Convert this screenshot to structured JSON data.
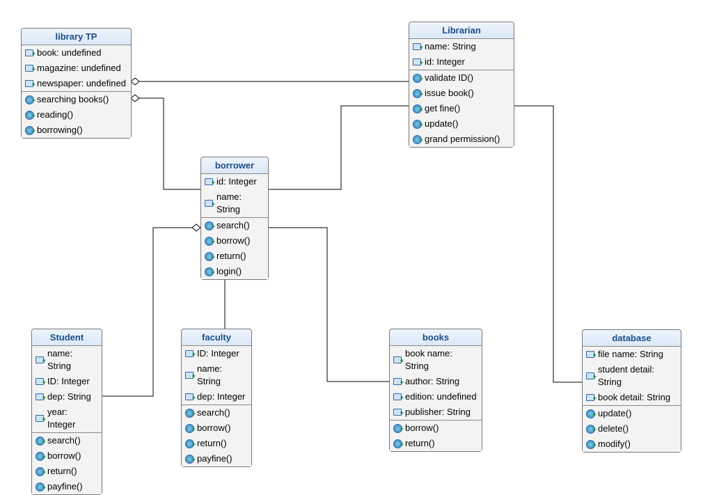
{
  "classes": {
    "libraryTP": {
      "title": "library TP",
      "attrs": [
        "book: undefined",
        "magazine: undefined",
        "newspaper: undefined"
      ],
      "methods": [
        "searching books()",
        "reading()",
        "borrowing()"
      ]
    },
    "librarian": {
      "title": "Librarian",
      "attrs": [
        "name: String",
        "id: Integer"
      ],
      "methods": [
        "validate ID()",
        "issue book()",
        "get fine()",
        "update()",
        "grand permission()"
      ]
    },
    "borrower": {
      "title": "borrower",
      "attrs": [
        "id: Integer",
        "name: String"
      ],
      "methods": [
        "search()",
        "borrow()",
        "return()",
        "login()"
      ]
    },
    "student": {
      "title": "Student",
      "attrs": [
        "name: String",
        "ID: Integer",
        "dep: String",
        "year: Integer"
      ],
      "methods": [
        "search()",
        "borrow()",
        "return()",
        "payfine()"
      ]
    },
    "faculty": {
      "title": "faculty",
      "attrs": [
        "ID: Integer",
        "name: String",
        "dep: Integer"
      ],
      "methods": [
        "search()",
        "borrow()",
        "return()",
        "payfine()"
      ]
    },
    "books": {
      "title": "books",
      "attrs": [
        "book name: String",
        "author: String",
        "edition: undefined",
        "publisher: String"
      ],
      "methods": [
        "borrow()",
        "return()"
      ]
    },
    "database": {
      "title": "database",
      "attrs": [
        "file name: String",
        "student detail: String",
        "book detail: String"
      ],
      "methods": [
        "update()",
        "delete()",
        "modify()"
      ]
    }
  },
  "chart_data": {
    "type": "uml-class-diagram",
    "classes": [
      {
        "name": "library TP",
        "attributes": [
          "book: undefined",
          "magazine: undefined",
          "newspaper: undefined"
        ],
        "operations": [
          "searching books()",
          "reading()",
          "borrowing()"
        ]
      },
      {
        "name": "Librarian",
        "attributes": [
          "name: String",
          "id: Integer"
        ],
        "operations": [
          "validate ID()",
          "issue book()",
          "get fine()",
          "update()",
          "grand permission()"
        ]
      },
      {
        "name": "borrower",
        "attributes": [
          "id: Integer",
          "name: String"
        ],
        "operations": [
          "search()",
          "borrow()",
          "return()",
          "login()"
        ]
      },
      {
        "name": "Student",
        "attributes": [
          "name: String",
          "ID: Integer",
          "dep: String",
          "year: Integer"
        ],
        "operations": [
          "search()",
          "borrow()",
          "return()",
          "payfine()"
        ]
      },
      {
        "name": "faculty",
        "attributes": [
          "ID: Integer",
          "name: String",
          "dep: Integer"
        ],
        "operations": [
          "search()",
          "borrow()",
          "return()",
          "payfine()"
        ]
      },
      {
        "name": "books",
        "attributes": [
          "book name: String",
          "author: String",
          "edition: undefined",
          "publisher: String"
        ],
        "operations": [
          "borrow()",
          "return()"
        ]
      },
      {
        "name": "database",
        "attributes": [
          "file name: String",
          "student detail: String",
          "book detail: String"
        ],
        "operations": [
          "update()",
          "delete()",
          "modify()"
        ]
      }
    ],
    "relationships": [
      {
        "from": "Librarian",
        "to": "library TP",
        "type": "aggregation",
        "diamondAt": "library TP"
      },
      {
        "from": "borrower",
        "to": "library TP",
        "type": "aggregation",
        "diamondAt": "library TP"
      },
      {
        "from": "borrower",
        "to": "Librarian",
        "type": "association"
      },
      {
        "from": "Student",
        "to": "borrower",
        "type": "aggregation",
        "diamondAt": "borrower"
      },
      {
        "from": "faculty",
        "to": "borrower",
        "type": "aggregation",
        "diamondAt": "borrower"
      },
      {
        "from": "borrower",
        "to": "books",
        "type": "association"
      },
      {
        "from": "Librarian",
        "to": "database",
        "type": "association"
      }
    ]
  }
}
